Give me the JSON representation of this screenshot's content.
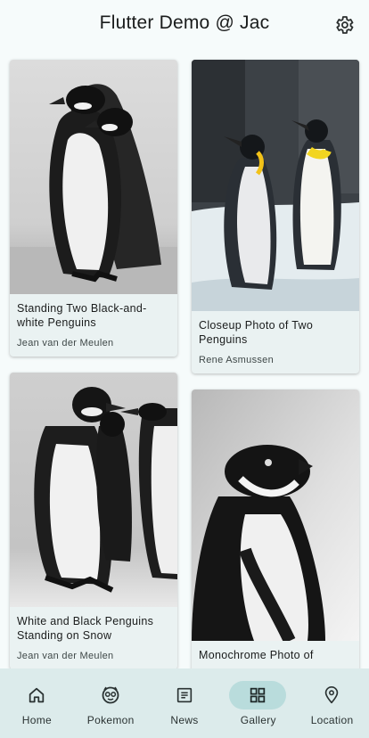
{
  "app": {
    "title": "Flutter Demo @ Jac"
  },
  "gallery": {
    "cards": [
      {
        "title": "Standing Two Black-and-white Penguins",
        "author": "Jean van der Meulen"
      },
      {
        "title": "Closeup Photo of Two Penguins",
        "author": "Rene Asmussen"
      },
      {
        "title": "White and Black Penguins Standing on Snow",
        "author": "Jean van der Meulen"
      },
      {
        "title": "Monochrome Photo of",
        "author": ""
      }
    ]
  },
  "nav": {
    "items": [
      {
        "label": "Home",
        "icon": "home-icon"
      },
      {
        "label": "Pokemon",
        "icon": "pokeball-face-icon"
      },
      {
        "label": "News",
        "icon": "news-icon"
      },
      {
        "label": "Gallery",
        "icon": "grid-icon",
        "active": true
      },
      {
        "label": "Location",
        "icon": "location-pin-icon"
      }
    ]
  },
  "colors": {
    "background": "#f6fbfb",
    "card": "#eaf2f2",
    "navbar": "#dcebeb",
    "active_pill": "#b9dcdc"
  }
}
